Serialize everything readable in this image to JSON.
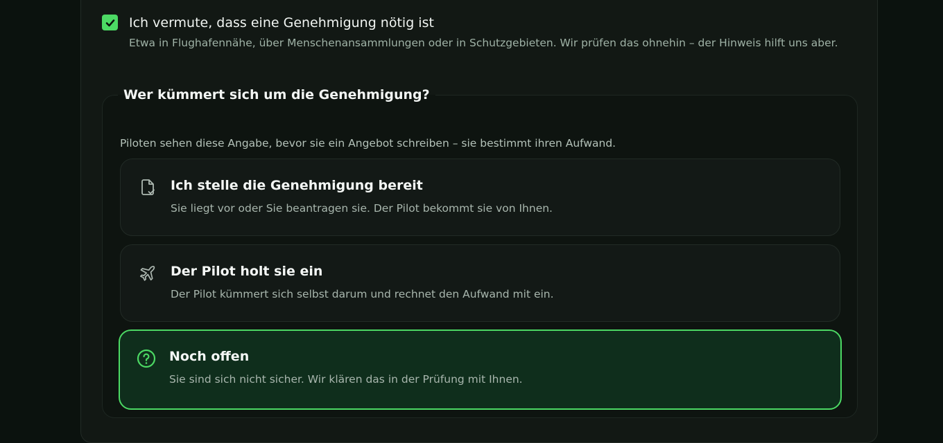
{
  "permit_checkbox": {
    "checked": true,
    "label": "Ich vermute, dass eine Genehmigung nötig ist",
    "help": "Etwa in Flughafennähe, über Menschenansammlungen oder in Schutzgebieten. Wir prüfen das ohnehin – der Hinweis hilft uns aber."
  },
  "permit_responsibility": {
    "legend": "Wer kümmert sich um die Genehmigung?",
    "help": "Piloten sehen diese Angabe, bevor sie ein Angebot schreiben – sie bestimmt ihren Aufwand.",
    "selected": "open",
    "options": [
      {
        "id": "client",
        "icon": "file-check-icon",
        "title": "Ich stelle die Genehmigung bereit",
        "description": "Sie liegt vor oder Sie beantragen sie. Der Pilot bekommt sie von Ihnen."
      },
      {
        "id": "pilot",
        "icon": "plane-icon",
        "title": "Der Pilot holt sie ein",
        "description": "Der Pilot kümmert sich selbst darum und rechnet den Aufwand mit ein."
      },
      {
        "id": "open",
        "icon": "question-circle-icon",
        "title": "Noch offen",
        "description": "Sie sind sich nicht sicher. Wir klären das in der Prüfung mit Ihnen."
      }
    ]
  },
  "colors": {
    "accent": "#4cd964",
    "selected_background": "#0f2e1c",
    "page_background": "#0b120e"
  }
}
